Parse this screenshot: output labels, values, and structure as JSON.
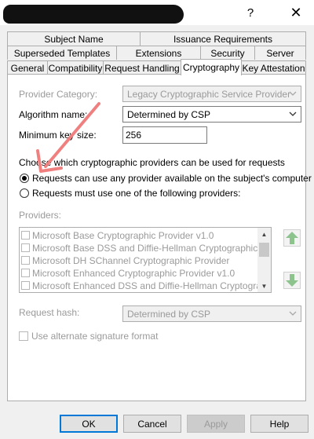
{
  "window": {
    "help_glyph": "?",
    "close_glyph": "✕"
  },
  "tabs": {
    "row1": [
      "Subject Name",
      "Issuance Requirements"
    ],
    "row2": [
      "Superseded Templates",
      "Extensions",
      "Security",
      "Server"
    ],
    "row3": [
      "General",
      "Compatibility",
      "Request Handling",
      "Cryptography",
      "Key Attestation"
    ],
    "active": "Cryptography"
  },
  "form": {
    "provider_category_label": "Provider Category:",
    "provider_category_value": "Legacy Cryptographic Service Provider",
    "algorithm_label": "Algorithm name:",
    "algorithm_value": "Determined by CSP",
    "min_key_label": "Minimum key size:",
    "min_key_value": "256",
    "choose_label": "Choose which cryptographic providers can be used for requests",
    "radio_any": "Requests can use any provider available on the subject's computer",
    "radio_any_selected": true,
    "radio_following": "Requests must use one of the following providers:",
    "providers_label": "Providers:",
    "providers": [
      "Microsoft Base Cryptographic Provider v1.0",
      "Microsoft Base DSS and Diffie-Hellman Cryptographic Provide",
      "Microsoft DH SChannel Cryptographic Provider",
      "Microsoft Enhanced Cryptographic Provider v1.0",
      "Microsoft Enhanced DSS and Diffie-Hellman Cryptographic Pr"
    ],
    "request_hash_label": "Request hash:",
    "request_hash_value": "Determined by CSP",
    "alt_signature_label": "Use alternate signature format"
  },
  "buttons": {
    "ok": "OK",
    "cancel": "Cancel",
    "apply": "Apply",
    "help": "Help"
  },
  "colors": {
    "accent": "#0078d7",
    "annotation_arrow": "#f08080",
    "move_arrows": "#8dc38d"
  }
}
